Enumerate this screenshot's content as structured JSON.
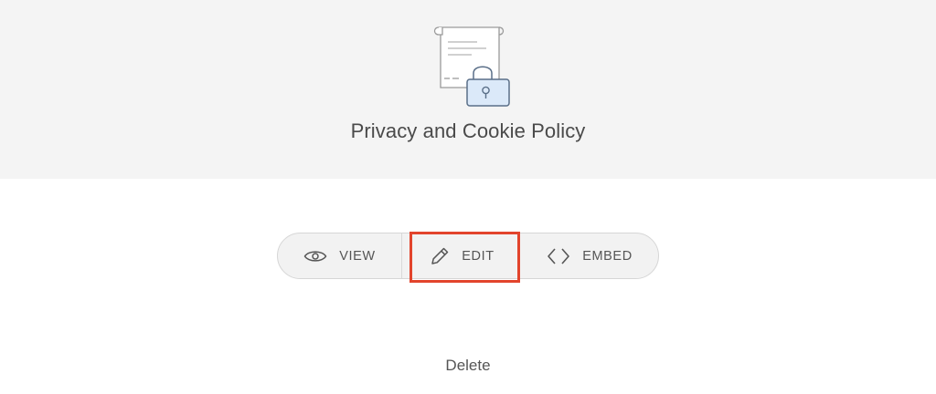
{
  "document": {
    "title": "Privacy and Cookie Policy",
    "illustration": "document-with-padlock-icon"
  },
  "actions": {
    "view_label": "VIEW",
    "view_icon": "eye-icon",
    "edit_label": "EDIT",
    "edit_icon": "pencil-icon",
    "embed_label": "EMBED",
    "embed_icon": "code-brackets-icon",
    "highlighted": "EDIT",
    "highlight_color": "#e2442c"
  },
  "footer": {
    "delete_label": "Delete"
  },
  "colors": {
    "header_background": "#f4f4f4",
    "button_group_background": "#f2f2f2",
    "lock_fill": "#dbe9f9",
    "lock_stroke": "#5a6f88"
  }
}
